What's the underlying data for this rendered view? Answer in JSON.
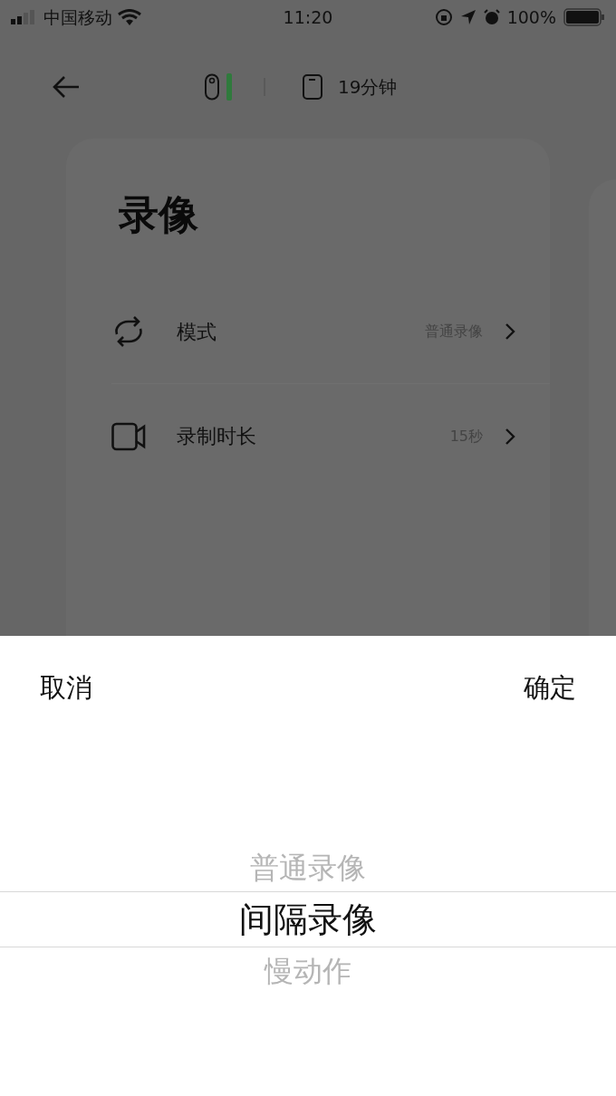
{
  "status_bar": {
    "carrier": "中国移动",
    "time": "11:20",
    "battery": "100%"
  },
  "header": {
    "storage": "19分钟"
  },
  "card": {
    "title": "录像",
    "rows": [
      {
        "kind": "mode",
        "label": "模式",
        "value": "普通录像"
      },
      {
        "kind": "duration",
        "label": "录制时长",
        "value": "15秒"
      }
    ]
  },
  "picker": {
    "cancel": "取消",
    "confirm": "确定",
    "options": [
      {
        "label": "普通录像",
        "selected": false
      },
      {
        "label": "间隔录像",
        "selected": true
      },
      {
        "label": "慢动作",
        "selected": false
      }
    ]
  }
}
